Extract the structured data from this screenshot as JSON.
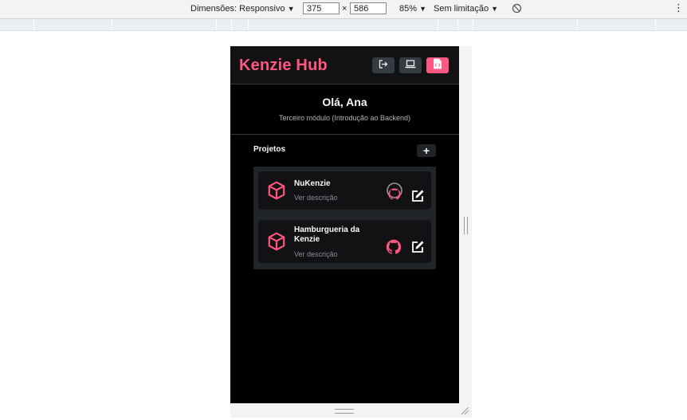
{
  "devtools": {
    "dimensions_label": "Dimensões: Responsivo",
    "width_value": "375",
    "times_sign": "×",
    "height_value": "586",
    "zoom_label": "85%",
    "throttle_label": "Sem limitação",
    "dropdown_arrow": "▼",
    "more_menu": "⋮"
  },
  "app": {
    "brand": "Kenzie Hub",
    "header_buttons": [
      {
        "icon": "logout-icon",
        "active": false
      },
      {
        "icon": "laptop-icon",
        "active": false
      },
      {
        "icon": "code-file-icon",
        "active": true
      }
    ],
    "greeting": "Olá, Ana",
    "module": "Terceiro módulo (Introdução ao Backend)",
    "projects_title": "Projetos",
    "add_label": "+",
    "projects": [
      {
        "title": "NuKenzie",
        "description": "Ver descrição"
      },
      {
        "title": "Hamburgueria da Kenzie",
        "description": "Ver descrição"
      }
    ]
  },
  "colors": {
    "brand_pink": "#ff577f",
    "surface": "#121214",
    "card_bg": "#212529",
    "border": "#343b41"
  }
}
